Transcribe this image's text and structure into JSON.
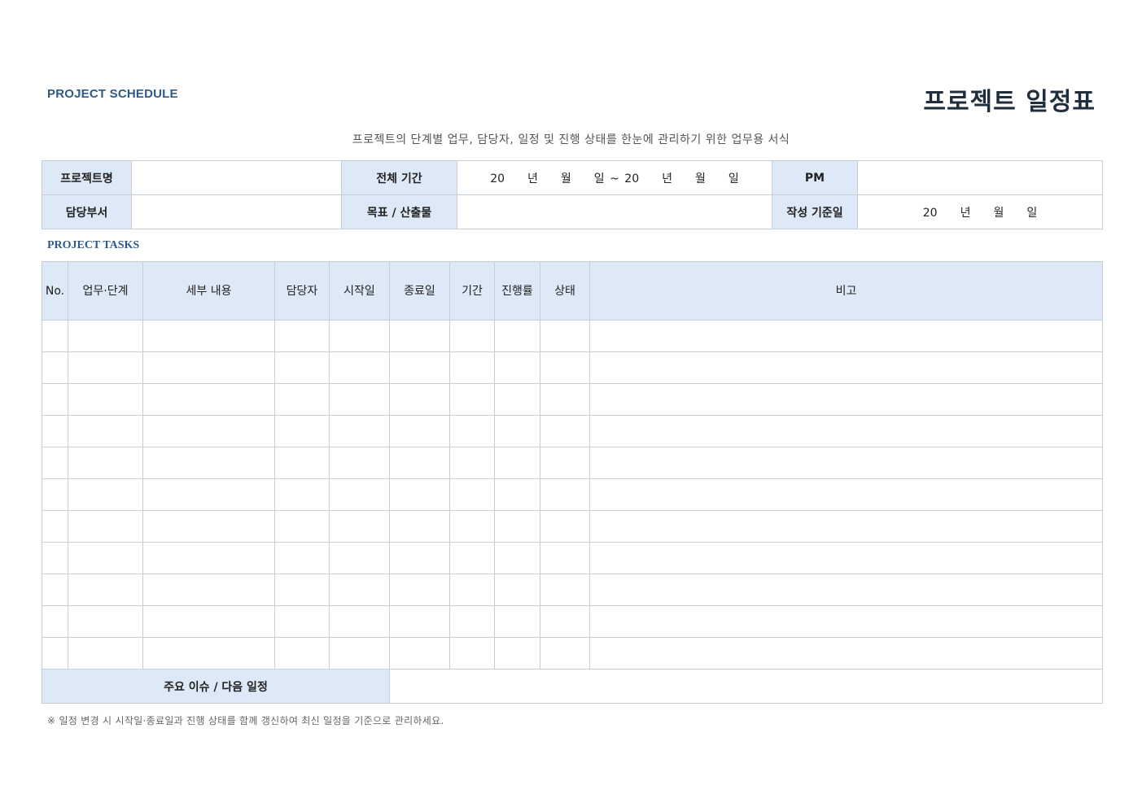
{
  "header": {
    "en_label": "PROJECT SCHEDULE",
    "title": "프로젝트 일정표",
    "subtitle": "프로젝트의 단계별 업무, 담당자, 일정 및 진행 상태를 한눈에 관리하기 위한 업무용 서식"
  },
  "info": {
    "project_name_label": "프로젝트명",
    "project_name_value": "",
    "period_label": "전체 기간",
    "period_value": "20　　년　　월　　일 ~ 20　　년　　월　　일",
    "pm_label": "PM",
    "pm_value": "",
    "dept_label": "담당부서",
    "dept_value": "",
    "goal_label": "목표 / 산출물",
    "goal_value": "",
    "date_label": "작성 기준일",
    "date_value": "20　　년　　월　　일"
  },
  "tasks": {
    "section_label": "PROJECT TASKS",
    "columns": [
      "No.",
      "업무·단계",
      "세부 내용",
      "담당자",
      "시작일",
      "종료일",
      "기간",
      "진행률",
      "상태",
      "비고"
    ],
    "row_count": 11,
    "footer_label": "주요 이슈 / 다음 일정",
    "footer_value": ""
  },
  "footnote": "※ 일정 변경 시 시작일·종료일과 진행 상태를 함께 갱신하여 최신 일정을 기준으로 관리하세요."
}
